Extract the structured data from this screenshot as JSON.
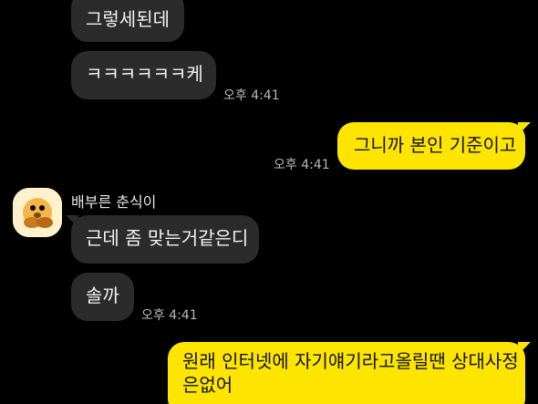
{
  "colors": {
    "background": "#000000",
    "incoming_bubble": "#2b2b2b",
    "outgoing_bubble": "#fee500",
    "incoming_text": "#f2f2f2",
    "outgoing_text": "#111111",
    "timestamp": "#b7b7b7"
  },
  "messages": [
    {
      "direction": "incoming",
      "text": "그렇세된데",
      "time": ""
    },
    {
      "direction": "incoming",
      "text": "ㅋㅋㅋㅋㅋㅋ케",
      "time": "오후 4:41"
    },
    {
      "direction": "outgoing",
      "text": "그니까 본인 기준이고",
      "time": "오후 4:41"
    },
    {
      "direction": "incoming",
      "sender": "배부른 춘식이",
      "avatar": "chunsik-avatar",
      "text": "근데 좀 맞는거같은디",
      "time": ""
    },
    {
      "direction": "incoming",
      "text": "솔까",
      "time": "오후 4:41"
    },
    {
      "direction": "outgoing",
      "text": "원래 인터넷에 자기얘기라고올릴땐 상대사정",
      "text_2": "은없어",
      "time": ""
    }
  ]
}
